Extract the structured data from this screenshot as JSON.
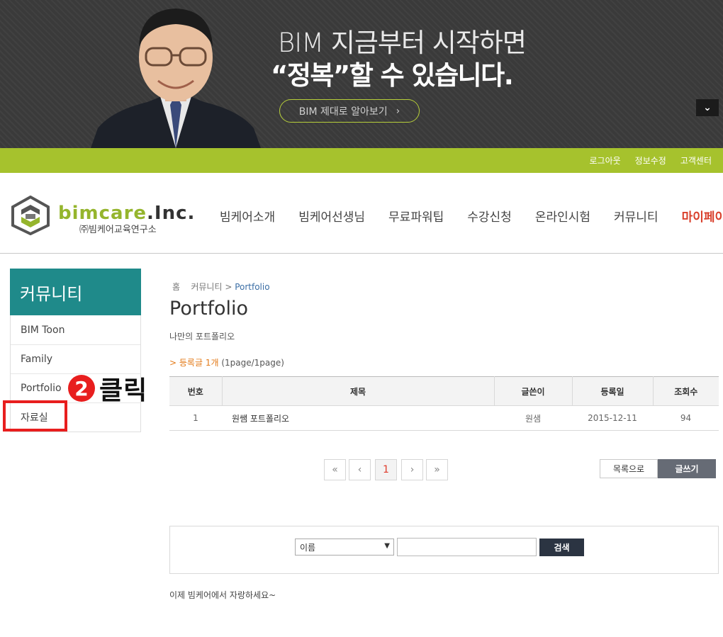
{
  "banner": {
    "line1": "BIM 지금부터 시작하면",
    "line2": "“정복”할 수 있습니다.",
    "button_label": "BIM 제대로 알아보기",
    "button_arrow": "›",
    "toggle_icon": "⌄"
  },
  "util": {
    "logout": "로그아웃",
    "edit_info": "정보수정",
    "support": "고객센터"
  },
  "logo": {
    "part1": "bimcare",
    "part2": ".Inc.",
    "sub": "㈜빔케어교육연구소"
  },
  "nav": {
    "items": [
      "빔케어소개",
      "빔케어선생님",
      "무료파워팁",
      "수강신청",
      "온라인시험",
      "커뮤니티"
    ],
    "active": "마이페이지"
  },
  "sidebar": {
    "title": "커뮤니티",
    "items": [
      "BIM Toon",
      "Family",
      "Portfolio",
      "자료실"
    ]
  },
  "annotation": {
    "number": "2",
    "text": "클릭"
  },
  "breadcrumb": {
    "home": "홈",
    "section": "커뮤니티",
    "sep": ">",
    "current": "Portfolio"
  },
  "page": {
    "title": "Portfolio",
    "subtitle": "나만의 포트폴리오",
    "count_arrow": ">",
    "count_label": "등록글 1개",
    "count_pages": "(1page/1page)"
  },
  "table": {
    "headers": [
      "번호",
      "제목",
      "글쓴이",
      "등록일",
      "조회수"
    ],
    "rows": [
      {
        "no": "1",
        "title": "원쌤 포트폴리오",
        "author": "원샘",
        "date": "2015-12-11",
        "views": "94"
      }
    ]
  },
  "pager": {
    "first": "«",
    "prev": "‹",
    "current": "1",
    "next": "›",
    "last": "»"
  },
  "buttons": {
    "list": "목록으로",
    "write": "글쓰기"
  },
  "search": {
    "field_selected": "이름",
    "input_value": "",
    "button": "검색"
  },
  "footer": {
    "message": "이제 빔케어에서 자랑하세요~"
  },
  "colors": {
    "accent_green": "#a6c22d",
    "sidebar_teal": "#1f8a8a",
    "nav_active": "#d9402c",
    "highlight_red": "#e81e1e"
  }
}
